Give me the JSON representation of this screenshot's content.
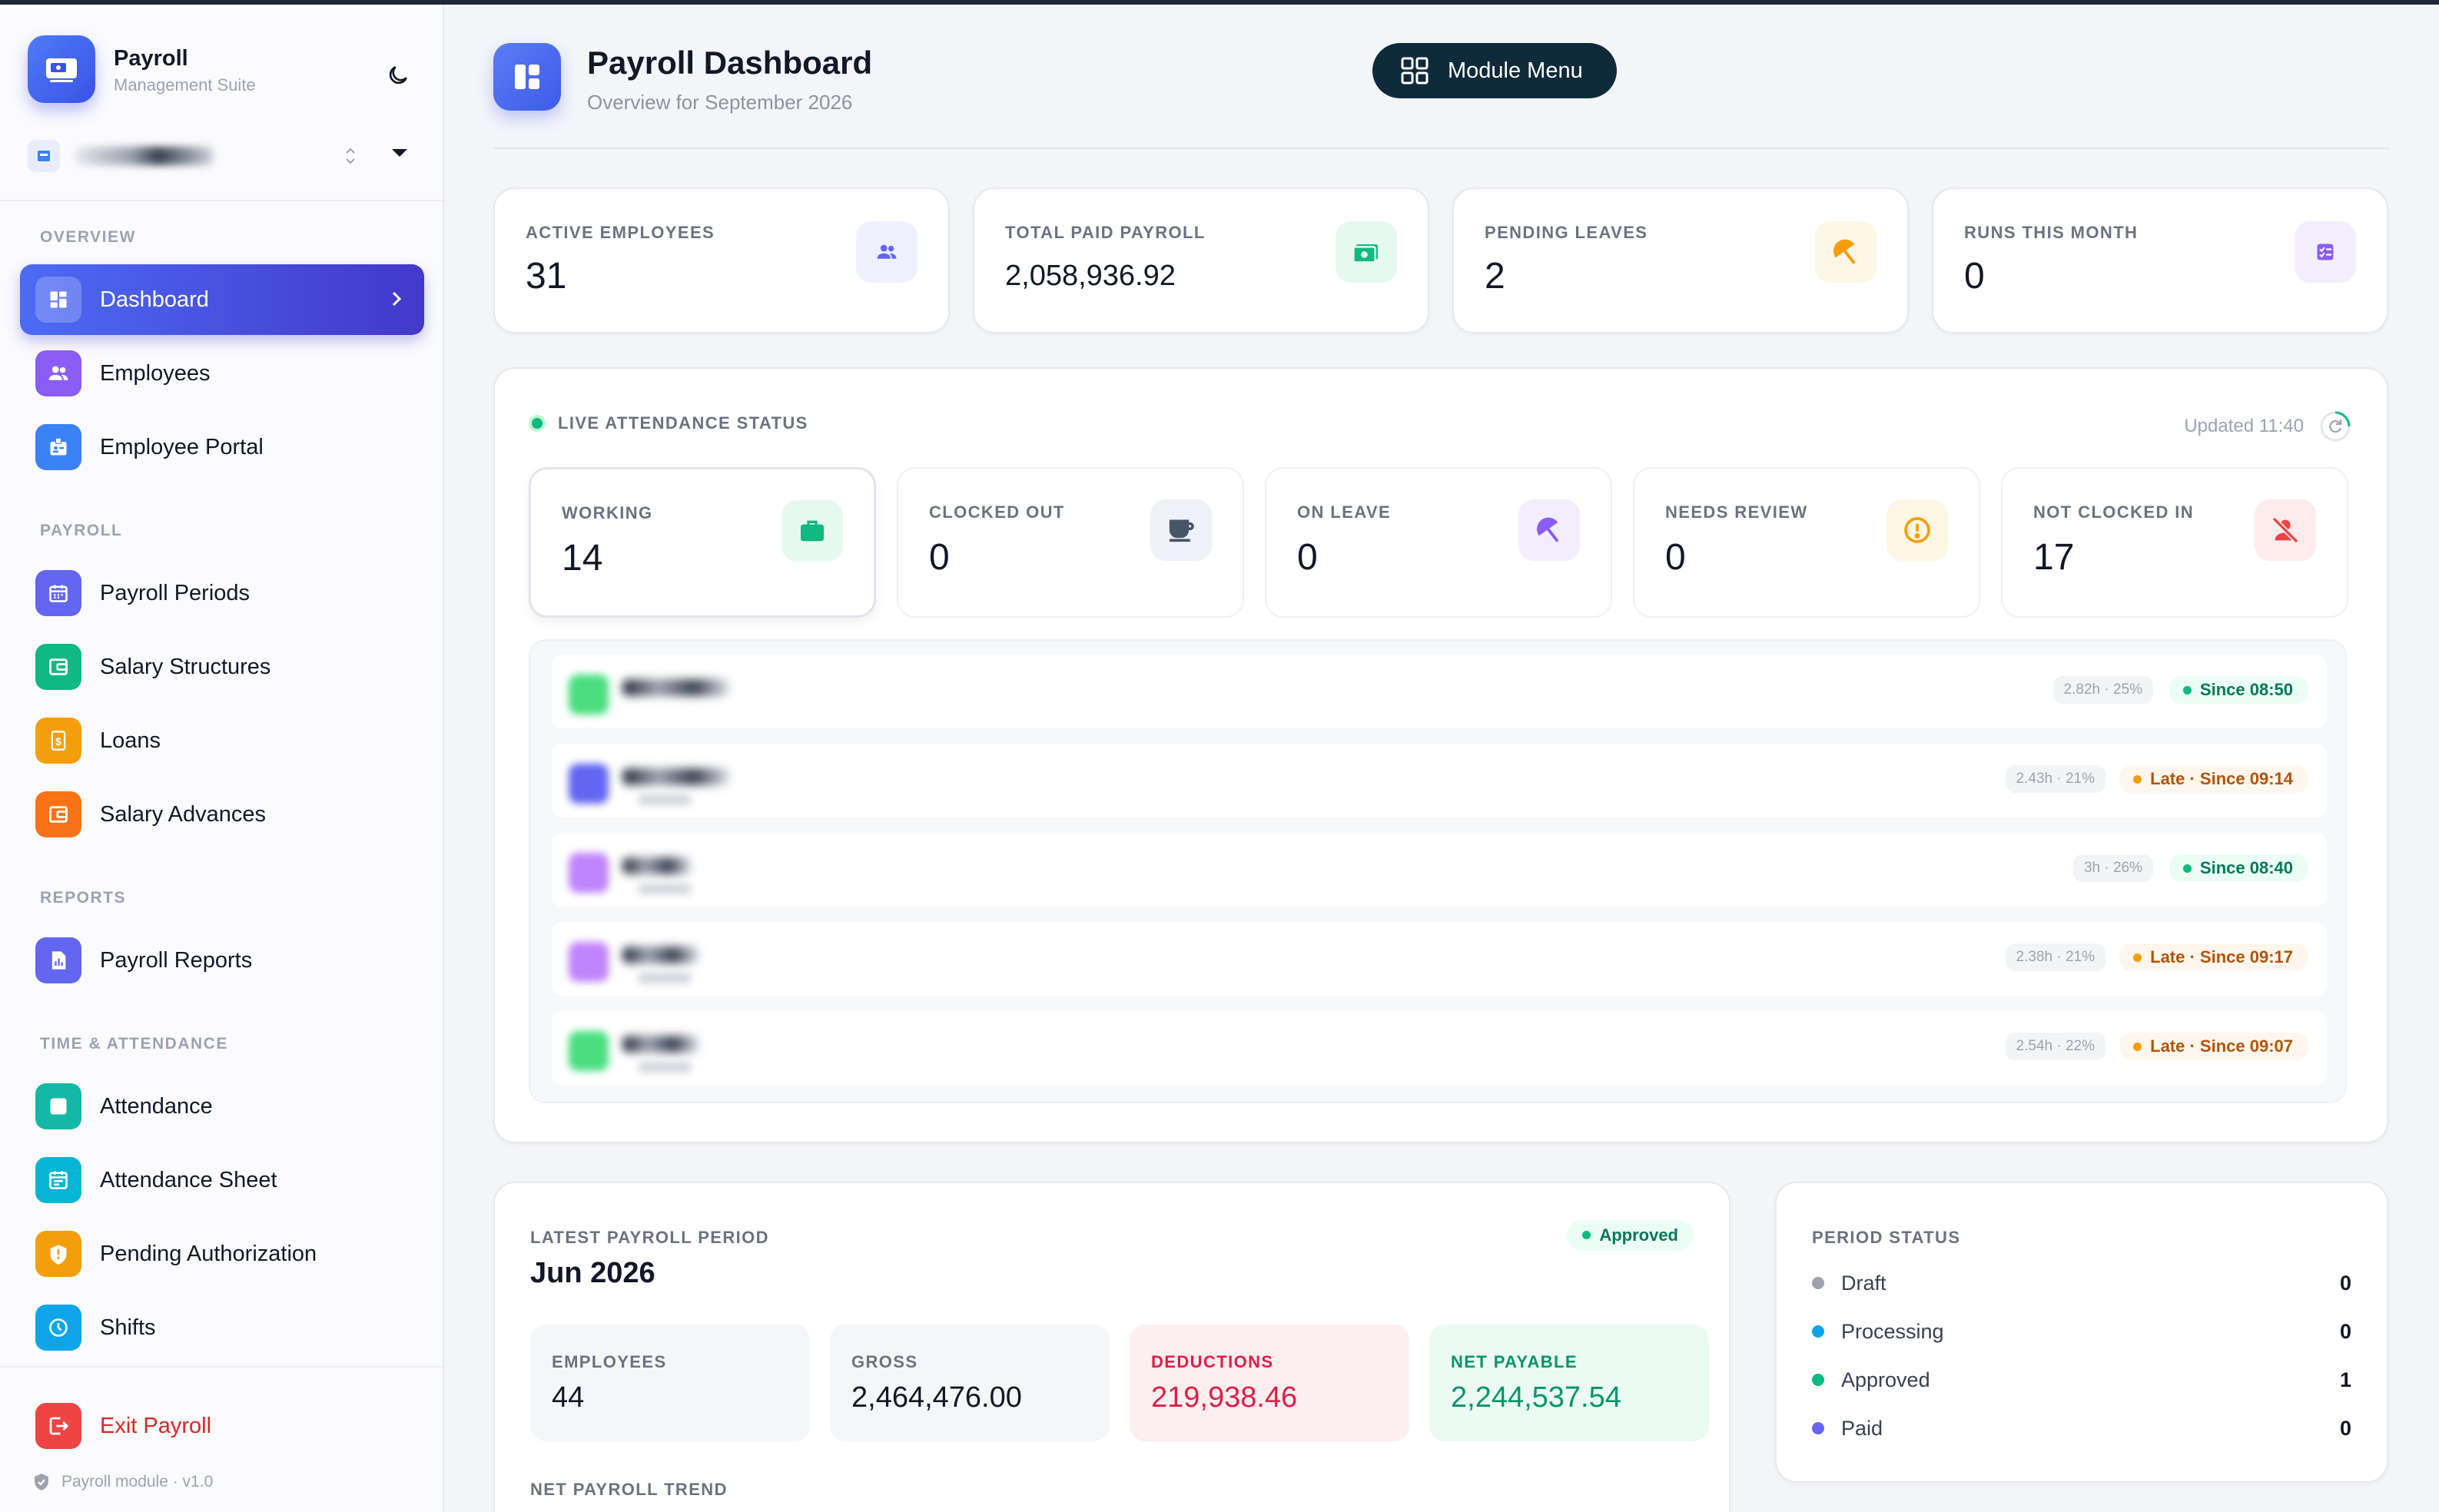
{
  "brand": {
    "name": "Payroll",
    "subtitle": "Management Suite"
  },
  "sidebar": {
    "sections": [
      {
        "title": "OVERVIEW",
        "items": [
          {
            "label": "Dashboard",
            "icon": "dashboard-icon",
            "color": "#4c6bf4",
            "active": true
          }
        ]
      },
      {
        "title": "",
        "items": [
          {
            "label": "Employees",
            "icon": "people-icon",
            "color": "#8b5cf6"
          },
          {
            "label": "Employee Portal",
            "icon": "badge-icon",
            "color": "#3b82f6"
          }
        ]
      },
      {
        "title": "PAYROLL",
        "items": [
          {
            "label": "Payroll Periods",
            "icon": "calendar-icon",
            "color": "#6366f1"
          },
          {
            "label": "Salary Structures",
            "icon": "wallet-icon",
            "color": "#10b981"
          },
          {
            "label": "Loans",
            "icon": "dollar-icon",
            "color": "#f59e0b"
          },
          {
            "label": "Salary Advances",
            "icon": "wallet-icon",
            "color": "#f97316"
          }
        ]
      },
      {
        "title": "REPORTS",
        "items": [
          {
            "label": "Payroll Reports",
            "icon": "report-icon",
            "color": "#6366f1"
          }
        ]
      },
      {
        "title": "TIME & ATTENDANCE",
        "items": [
          {
            "label": "Attendance",
            "icon": "checklist-icon",
            "color": "#14b8a6"
          },
          {
            "label": "Attendance Sheet",
            "icon": "sheet-icon",
            "color": "#06b6d4"
          },
          {
            "label": "Pending Authorization",
            "icon": "shield-icon",
            "color": "#f59e0b"
          },
          {
            "label": "Shifts",
            "icon": "clock-icon",
            "color": "#0ea5e9"
          }
        ]
      }
    ],
    "exit_label": "Exit Payroll",
    "version": "Payroll module · v1.0"
  },
  "header": {
    "title": "Payroll Dashboard",
    "subtitle": "Overview for September 2026",
    "menu_label": "Module Menu"
  },
  "stats": [
    {
      "label": "ACTIVE EMPLOYEES",
      "value": "31",
      "icon": "people-icon",
      "fg": "#6366f1",
      "bg": "#eef0fe"
    },
    {
      "label": "TOTAL PAID PAYROLL",
      "value": "2,058,936.92",
      "icon": "cash-icon",
      "fg": "#10b981",
      "bg": "#e7f8f0"
    },
    {
      "label": "PENDING LEAVES",
      "value": "2",
      "icon": "umbrella-icon",
      "fg": "#f59e0b",
      "bg": "#fef6e4"
    },
    {
      "label": "RUNS THIS MONTH",
      "value": "0",
      "icon": "checklist-icon",
      "fg": "#8b5cf6",
      "bg": "#f2eefe"
    }
  ],
  "live": {
    "title": "LIVE ATTENDANCE STATUS",
    "updated": "Updated 11:40",
    "tiles": [
      {
        "label": "WORKING",
        "value": "14",
        "icon": "briefcase-icon",
        "fg": "#10b981",
        "bg": "#e7f8f0"
      },
      {
        "label": "CLOCKED OUT",
        "value": "0",
        "icon": "coffee-icon",
        "fg": "#475569",
        "bg": "#eef1f5"
      },
      {
        "label": "ON LEAVE",
        "value": "0",
        "icon": "umbrella-icon",
        "fg": "#8b5cf6",
        "bg": "#f2eefe"
      },
      {
        "label": "NEEDS REVIEW",
        "value": "0",
        "icon": "alert-icon",
        "fg": "#f59e0b",
        "bg": "#fef6e4"
      },
      {
        "label": "NOT CLOCKED IN",
        "value": "17",
        "icon": "user-off-icon",
        "fg": "#ef4444",
        "bg": "#fdecec"
      }
    ],
    "rows": [
      {
        "hours": "2.82h · 25%",
        "status": "Since 08:50",
        "late": false,
        "avatar": "#4ade80"
      },
      {
        "hours": "2.43h · 21%",
        "status": "Late · Since 09:14",
        "late": true,
        "avatar": "#6366f1"
      },
      {
        "hours": "3h · 26%",
        "status": "Since 08:40",
        "late": false,
        "avatar": "#c084fc"
      },
      {
        "hours": "2.38h · 21%",
        "status": "Late · Since 09:17",
        "late": true,
        "avatar": "#c084fc"
      },
      {
        "hours": "2.54h · 22%",
        "status": "Late · Since 09:07",
        "late": true,
        "avatar": "#4ade80"
      }
    ]
  },
  "latest": {
    "label": "LATEST PAYROLL PERIOD",
    "period": "Jun 2026",
    "status": "Approved",
    "metrics": [
      {
        "label": "EMPLOYEES",
        "value": "44",
        "bg": "#f5f6f8",
        "fg": "#111827",
        "lc": "#6b7280"
      },
      {
        "label": "GROSS",
        "value": "2,464,476.00",
        "bg": "#f5f6f8",
        "fg": "#111827",
        "lc": "#6b7280"
      },
      {
        "label": "DEDUCTIONS",
        "value": "219,938.46",
        "bg": "#fdeff0",
        "fg": "#e11d48",
        "lc": "#e11d48"
      },
      {
        "label": "NET PAYABLE",
        "value": "2,244,537.54",
        "bg": "#ebfaf2",
        "fg": "#059669",
        "lc": "#059669"
      }
    ],
    "trend_label": "NET PAYROLL TREND"
  },
  "period_status": {
    "label": "PERIOD STATUS",
    "rows": [
      {
        "label": "Draft",
        "count": "0",
        "color": "#9ca3af"
      },
      {
        "label": "Processing",
        "count": "0",
        "color": "#0ea5e9"
      },
      {
        "label": "Approved",
        "count": "1",
        "color": "#10b981"
      },
      {
        "label": "Paid",
        "count": "0",
        "color": "#6366f1"
      }
    ]
  }
}
